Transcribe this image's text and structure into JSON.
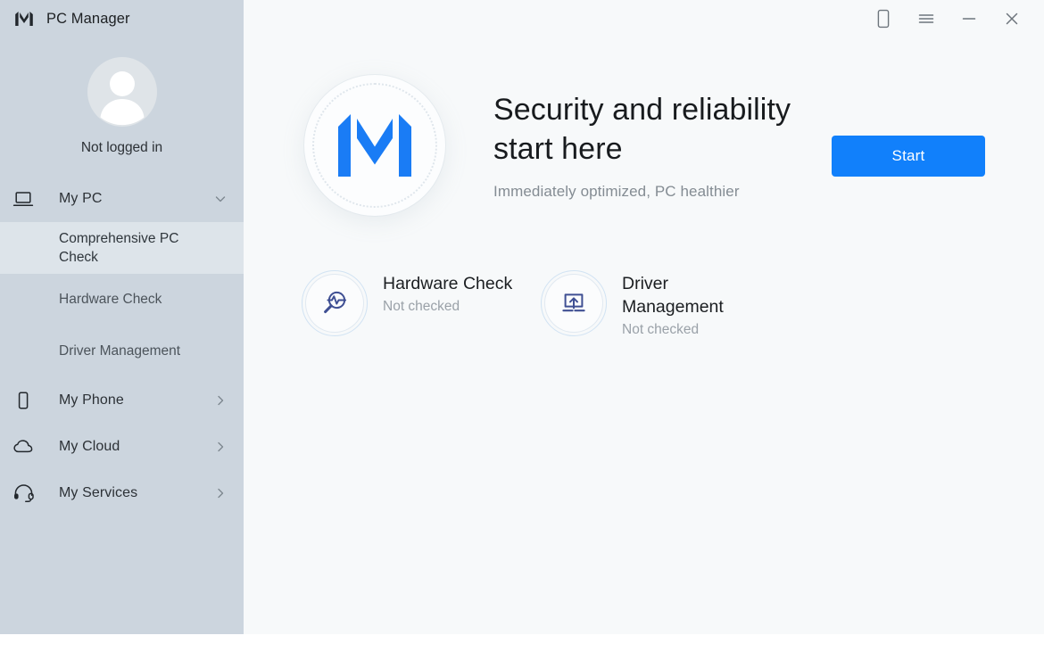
{
  "window": {
    "app_title": "PC Manager",
    "brand_logo_icon": "pc-manager-logo-icon",
    "controls": [
      {
        "name": "phone-link-icon",
        "label": "Phone"
      },
      {
        "name": "menu-icon",
        "label": "Menu"
      },
      {
        "name": "minimize-icon",
        "label": "Minimize"
      },
      {
        "name": "close-icon",
        "label": "Close"
      }
    ]
  },
  "sidebar": {
    "account": {
      "avatar_icon": "user-avatar-icon",
      "status_label": "Not logged in"
    },
    "nav": [
      {
        "label": "My PC",
        "icon": "laptop-icon",
        "chevron": "chevron-down-icon",
        "expanded": true,
        "children": [
          {
            "label": "Comprehensive PC Check",
            "active": true
          },
          {
            "label": "Hardware Check",
            "active": false
          },
          {
            "label": "Driver Management",
            "active": false
          }
        ]
      },
      {
        "label": "My Phone",
        "icon": "phone-icon",
        "chevron": "chevron-right-icon",
        "expanded": false,
        "children": []
      },
      {
        "label": "My Cloud",
        "icon": "cloud-icon",
        "chevron": "chevron-right-icon",
        "expanded": false,
        "children": []
      },
      {
        "label": "My Services",
        "icon": "headset-icon",
        "chevron": "chevron-right-icon",
        "expanded": false,
        "children": []
      }
    ]
  },
  "main": {
    "hero": {
      "logo_icon": "pc-manager-logo-icon",
      "title": "Security and reliability start here",
      "subtitle": "Immediately optimized, PC healthier",
      "start_button": "Start"
    },
    "features": [
      {
        "icon": "hardware-scan-icon",
        "title": "Hardware Check",
        "status": "Not checked"
      },
      {
        "icon": "driver-update-icon",
        "title": "Driver Management",
        "status": "Not checked"
      }
    ]
  },
  "colors": {
    "sidebar_bg": "#ccd5de",
    "sidebar_active_bg": "#dde4ea",
    "content_bg": "#f7f9fa",
    "accent_blue": "#1180fb",
    "logo_blue": "#1a7cf5",
    "feature_icon_navy": "#3f4f93",
    "muted_text": "#9aa1a8"
  }
}
